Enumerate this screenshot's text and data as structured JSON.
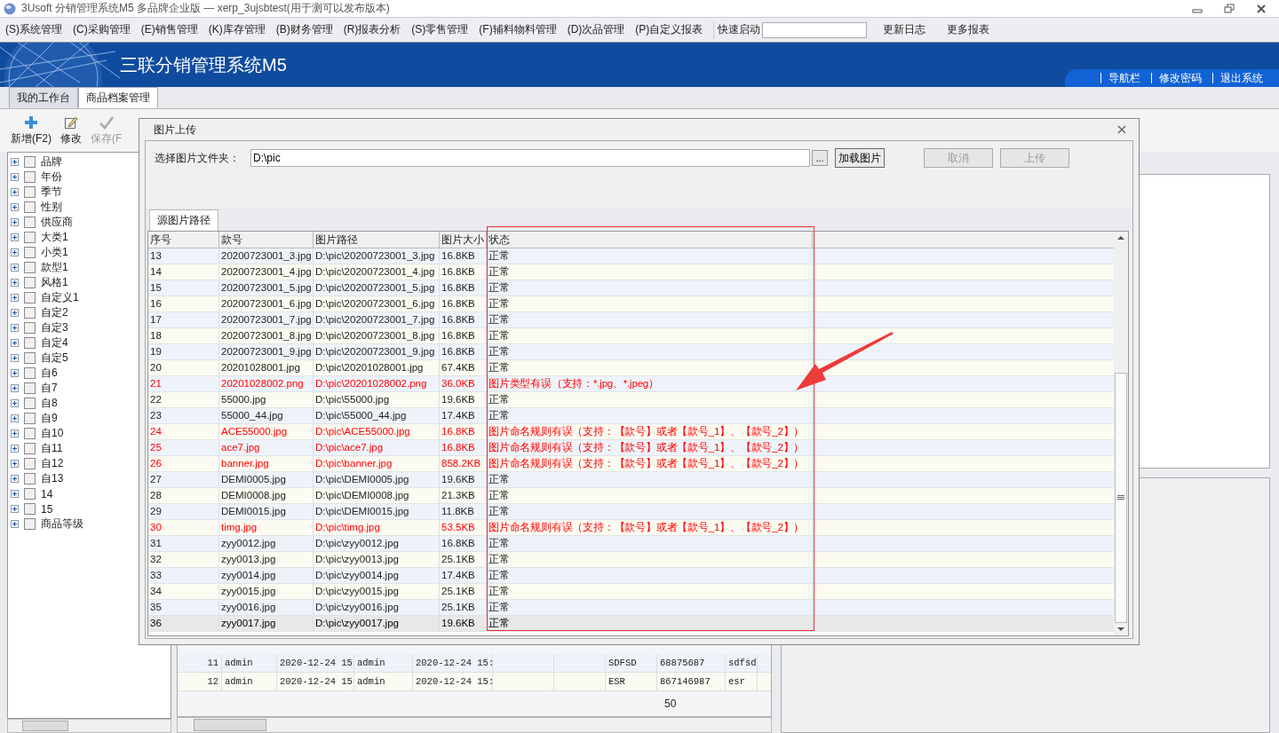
{
  "window": {
    "title": "3Usoft 分销管理系统M5 多品牌企业版 — xerp_3ujsbtest(用于测可以发布版本)"
  },
  "menu": [
    "(S)系统管理",
    "(C)采购管理",
    "(E)销售管理",
    "(K)库存管理",
    "(B)财务管理",
    "(R)报表分析",
    "(S)零售管理",
    "(F)辅料物料管理",
    "(D)次品管理",
    "(P)自定义报表"
  ],
  "quick_launch": {
    "label": "快速启动"
  },
  "menu_links": [
    "更新日志",
    "更多报表"
  ],
  "banner": {
    "title": "三联分销管理系统M5",
    "links": [
      "导航栏",
      "修改密码",
      "退出系统"
    ]
  },
  "tabs": [
    {
      "label": "我的工作台",
      "selected": false
    },
    {
      "label": "商品档案管理",
      "selected": true
    }
  ],
  "toolbar": [
    {
      "kind": "add",
      "label": "新增(F2)",
      "disabled": false
    },
    {
      "kind": "edit",
      "label": "修改",
      "disabled": false
    },
    {
      "kind": "save",
      "label": "保存(F",
      "disabled": true
    }
  ],
  "tree": [
    {
      "label": "品牌",
      "checked": false,
      "expanded": false
    },
    {
      "label": "年份",
      "checked": false,
      "expanded": false
    },
    {
      "label": "季节",
      "checked": false,
      "expanded": false
    },
    {
      "label": "性别",
      "checked": false,
      "expanded": false
    },
    {
      "label": "供应商",
      "checked": false,
      "expanded": false
    },
    {
      "label": "大类1",
      "checked": false,
      "expanded": false
    },
    {
      "label": "小类1",
      "checked": false,
      "expanded": false
    },
    {
      "label": "款型1",
      "checked": false,
      "expanded": false
    },
    {
      "label": "风格1",
      "checked": false,
      "expanded": false
    },
    {
      "label": "自定义1",
      "checked": false,
      "expanded": false
    },
    {
      "label": "自定2",
      "checked": false,
      "expanded": false
    },
    {
      "label": "自定3",
      "checked": false,
      "expanded": false
    },
    {
      "label": "自定4",
      "checked": false,
      "expanded": false
    },
    {
      "label": "自定5",
      "checked": false,
      "expanded": false
    },
    {
      "label": "自6",
      "checked": false,
      "expanded": false
    },
    {
      "label": "自7",
      "checked": false,
      "expanded": false
    },
    {
      "label": "自8",
      "checked": false,
      "expanded": false
    },
    {
      "label": "自9",
      "checked": false,
      "expanded": false
    },
    {
      "label": "自10",
      "checked": false,
      "expanded": false
    },
    {
      "label": "自11",
      "checked": false,
      "expanded": false
    },
    {
      "label": "自12",
      "checked": false,
      "expanded": false
    },
    {
      "label": "自13",
      "checked": false,
      "expanded": false
    },
    {
      "label": "14",
      "checked": false,
      "expanded": false
    },
    {
      "label": "15",
      "checked": false,
      "expanded": false
    },
    {
      "label": "商品等级",
      "checked": false,
      "expanded": false
    }
  ],
  "background_grid": {
    "rows": [
      [
        "11",
        "admin",
        "2020-12-24 15",
        "admin",
        "2020-12-24 15:",
        "",
        "",
        "SDFSD",
        "68875687",
        "sdfsd"
      ],
      [
        "12",
        "admin",
        "2020-12-24 15",
        "admin",
        "2020-12-24 15:",
        "",
        "",
        "ESR",
        "867146987",
        "esr"
      ]
    ],
    "footer": "50"
  },
  "dialog": {
    "title": "图片上传",
    "folder_label": "选择图片文件夹：",
    "folder_value": "D:\\pic",
    "browse_button": "...",
    "load_button": "加载图片",
    "cancel_button": {
      "label": "取消",
      "disabled": true
    },
    "upload_button": {
      "label": "上传",
      "disabled": true
    },
    "tab": {
      "label": "源图片路径",
      "selected": true
    },
    "table": {
      "columns": [
        "序号",
        "款号",
        "图片路径",
        "图片大小",
        "状态"
      ],
      "rows": [
        {
          "cells": [
            "13",
            "20200723001_3.jpg",
            "D:\\pic\\20200723001_3.jpg",
            "16.8KB",
            "正常"
          ],
          "error": false,
          "selected": false
        },
        {
          "cells": [
            "14",
            "20200723001_4.jpg",
            "D:\\pic\\20200723001_4.jpg",
            "16.8KB",
            "正常"
          ],
          "error": false,
          "selected": false
        },
        {
          "cells": [
            "15",
            "20200723001_5.jpg",
            "D:\\pic\\20200723001_5.jpg",
            "16.8KB",
            "正常"
          ],
          "error": false,
          "selected": false
        },
        {
          "cells": [
            "16",
            "20200723001_6.jpg",
            "D:\\pic\\20200723001_6.jpg",
            "16.8KB",
            "正常"
          ],
          "error": false,
          "selected": false
        },
        {
          "cells": [
            "17",
            "20200723001_7.jpg",
            "D:\\pic\\20200723001_7.jpg",
            "16.8KB",
            "正常"
          ],
          "error": false,
          "selected": false
        },
        {
          "cells": [
            "18",
            "20200723001_8.jpg",
            "D:\\pic\\20200723001_8.jpg",
            "16.8KB",
            "正常"
          ],
          "error": false,
          "selected": false
        },
        {
          "cells": [
            "19",
            "20200723001_9.jpg",
            "D:\\pic\\20200723001_9.jpg",
            "16.8KB",
            "正常"
          ],
          "error": false,
          "selected": false
        },
        {
          "cells": [
            "20",
            "20201028001.jpg",
            "D:\\pic\\20201028001.jpg",
            "67.4KB",
            "正常"
          ],
          "error": false,
          "selected": false
        },
        {
          "cells": [
            "21",
            "20201028002.png",
            "D:\\pic\\20201028002.png",
            "36.0KB",
            "图片类型有误（支持：*.jpg、*.jpeg）"
          ],
          "error": true,
          "selected": false
        },
        {
          "cells": [
            "22",
            "55000.jpg",
            "D:\\pic\\55000.jpg",
            "19.6KB",
            "正常"
          ],
          "error": false,
          "selected": false
        },
        {
          "cells": [
            "23",
            "55000_44.jpg",
            "D:\\pic\\55000_44.jpg",
            "17.4KB",
            "正常"
          ],
          "error": false,
          "selected": false
        },
        {
          "cells": [
            "24",
            "ACE55000.jpg",
            "D:\\pic\\ACE55000.jpg",
            "16.8KB",
            "图片命名规则有误（支持：【款号】或者【款号_1】、【款号_2】）"
          ],
          "error": true,
          "selected": false
        },
        {
          "cells": [
            "25",
            "ace7.jpg",
            "D:\\pic\\ace7.jpg",
            "16.8KB",
            "图片命名规则有误（支持：【款号】或者【款号_1】、【款号_2】）"
          ],
          "error": true,
          "selected": false
        },
        {
          "cells": [
            "26",
            "banner.jpg",
            "D:\\pic\\banner.jpg",
            "858.2KB",
            "图片命名规则有误（支持：【款号】或者【款号_1】、【款号_2】）"
          ],
          "error": true,
          "selected": false
        },
        {
          "cells": [
            "27",
            "DEMI0005.jpg",
            "D:\\pic\\DEMI0005.jpg",
            "19.6KB",
            "正常"
          ],
          "error": false,
          "selected": false
        },
        {
          "cells": [
            "28",
            "DEMI0008.jpg",
            "D:\\pic\\DEMI0008.jpg",
            "21.3KB",
            "正常"
          ],
          "error": false,
          "selected": false
        },
        {
          "cells": [
            "29",
            "DEMI0015.jpg",
            "D:\\pic\\DEMI0015.jpg",
            "11.8KB",
            "正常"
          ],
          "error": false,
          "selected": false
        },
        {
          "cells": [
            "30",
            "timg.jpg",
            "D:\\pic\\timg.jpg",
            "53.5KB",
            "图片命名规则有误（支持：【款号】或者【款号_1】、【款号_2】）"
          ],
          "error": true,
          "selected": false
        },
        {
          "cells": [
            "31",
            "zyy0012.jpg",
            "D:\\pic\\zyy0012.jpg",
            "16.8KB",
            "正常"
          ],
          "error": false,
          "selected": false
        },
        {
          "cells": [
            "32",
            "zyy0013.jpg",
            "D:\\pic\\zyy0013.jpg",
            "25.1KB",
            "正常"
          ],
          "error": false,
          "selected": false
        },
        {
          "cells": [
            "33",
            "zyy0014.jpg",
            "D:\\pic\\zyy0014.jpg",
            "17.4KB",
            "正常"
          ],
          "error": false,
          "selected": false
        },
        {
          "cells": [
            "34",
            "zyy0015.jpg",
            "D:\\pic\\zyy0015.jpg",
            "25.1KB",
            "正常"
          ],
          "error": false,
          "selected": false
        },
        {
          "cells": [
            "35",
            "zyy0016.jpg",
            "D:\\pic\\zyy0016.jpg",
            "25.1KB",
            "正常"
          ],
          "error": false,
          "selected": false
        },
        {
          "cells": [
            "36",
            "zyy0017.jpg",
            "D:\\pic\\zyy0017.jpg",
            "19.6KB",
            "正常"
          ],
          "error": false,
          "selected": true
        }
      ]
    }
  }
}
